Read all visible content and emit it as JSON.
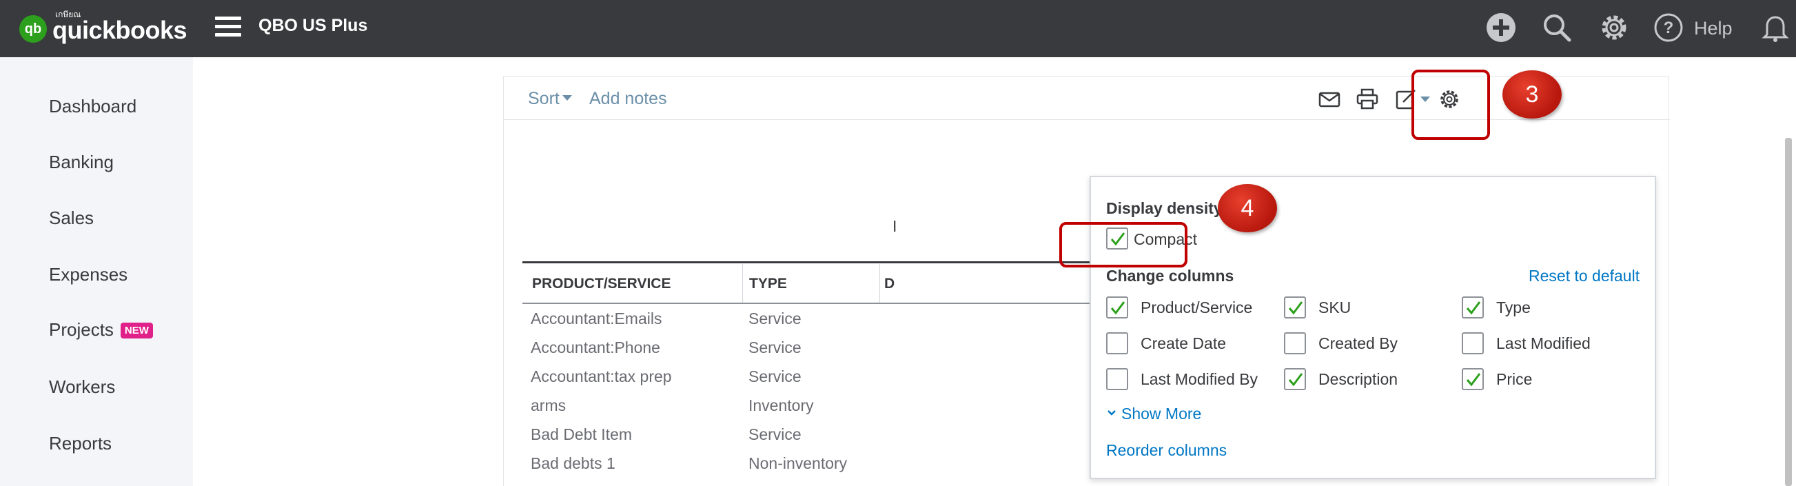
{
  "topbar": {
    "logo_thai": "เกษียณ",
    "logo_mark": "qb",
    "logo_word": "quickbooks",
    "company": "QBO US Plus",
    "help_label": "Help"
  },
  "nav": {
    "items": [
      {
        "label": "Dashboard"
      },
      {
        "label": "Banking"
      },
      {
        "label": "Sales"
      },
      {
        "label": "Expenses"
      },
      {
        "label": "Projects",
        "badge": "NEW"
      },
      {
        "label": "Workers"
      },
      {
        "label": "Reports"
      }
    ]
  },
  "toolbar": {
    "sort_label": "Sort",
    "add_notes_label": "Add notes"
  },
  "table": {
    "headers": [
      "PRODUCT/SERVICE",
      "TYPE",
      "D"
    ],
    "rows": [
      {
        "product": "Accountant:Emails",
        "type": "Service"
      },
      {
        "product": "Accountant:Phone",
        "type": "Service"
      },
      {
        "product": "Accountant:tax prep",
        "type": "Service"
      },
      {
        "product": "arms",
        "type": "Inventory"
      },
      {
        "product": "Bad Debt Item",
        "type": "Service"
      },
      {
        "product": "Bad debts 1",
        "type": "Non-inventory"
      }
    ],
    "partial_letter": "I"
  },
  "panel": {
    "density_heading": "Display density",
    "compact_label": "Compact",
    "compact_checked": true,
    "columns_heading": "Change columns",
    "reset_label": "Reset to default",
    "columns": [
      {
        "label": "Product/Service",
        "checked": true
      },
      {
        "label": "SKU",
        "checked": true
      },
      {
        "label": "Type",
        "checked": true
      },
      {
        "label": "Create Date",
        "checked": false
      },
      {
        "label": "Created By",
        "checked": false
      },
      {
        "label": "Last Modified",
        "checked": false
      },
      {
        "label": "Last Modified By",
        "checked": false
      },
      {
        "label": "Description",
        "checked": true
      },
      {
        "label": "Price",
        "checked": true
      }
    ],
    "show_more_label": "Show More",
    "reorder_label": "Reorder columns"
  },
  "callouts": {
    "step3": "3",
    "step4": "4"
  },
  "colors": {
    "topbar": "#393a3d",
    "brand_green": "#2ca01c",
    "link_blue": "#0077c5",
    "callout_red": "#c00000"
  }
}
